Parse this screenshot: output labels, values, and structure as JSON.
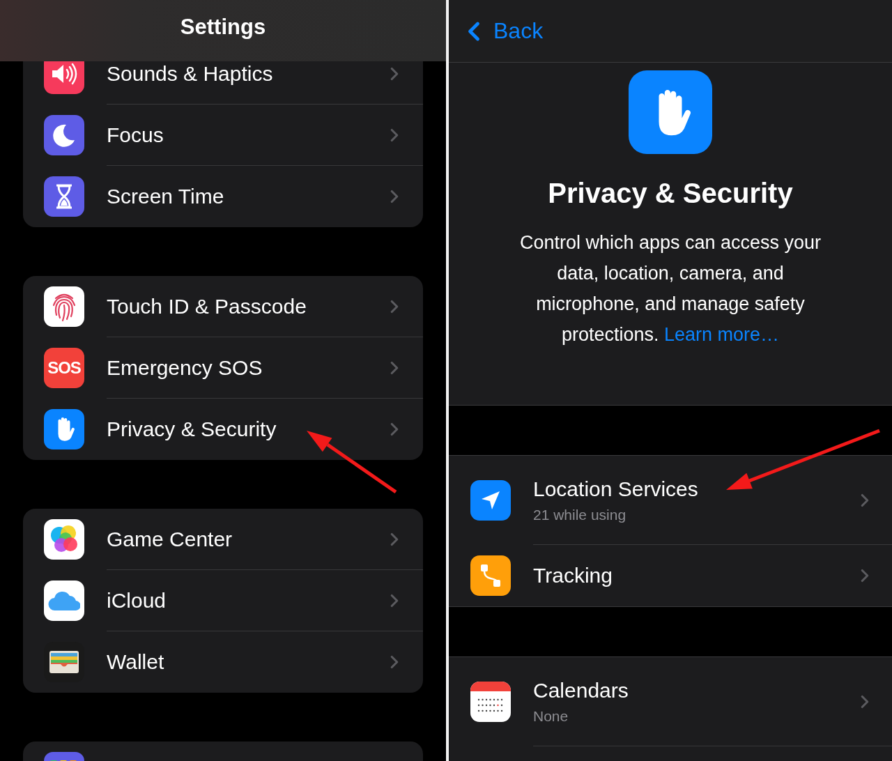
{
  "settings_screen": {
    "title": "Settings",
    "groups": [
      {
        "items": [
          {
            "label": "Sounds & Haptics"
          },
          {
            "label": "Focus"
          },
          {
            "label": "Screen Time"
          }
        ]
      },
      {
        "items": [
          {
            "label": "Touch ID & Passcode"
          },
          {
            "label": "Emergency SOS",
            "icon_text": "SOS"
          },
          {
            "label": "Privacy & Security"
          }
        ]
      },
      {
        "items": [
          {
            "label": "Game Center"
          },
          {
            "label": "iCloud"
          },
          {
            "label": "Wallet"
          }
        ]
      }
    ]
  },
  "privacy_screen": {
    "back_label": "Back",
    "title": "Privacy & Security",
    "description": "Control which apps can access your data, location, camera, and microphone, and manage safety protections.",
    "link": "Learn more…",
    "groups": [
      {
        "items": [
          {
            "label": "Location Services",
            "detail": "21 while using"
          },
          {
            "label": "Tracking"
          }
        ]
      },
      {
        "items": [
          {
            "label": "Calendars",
            "detail": "None"
          }
        ]
      }
    ]
  }
}
